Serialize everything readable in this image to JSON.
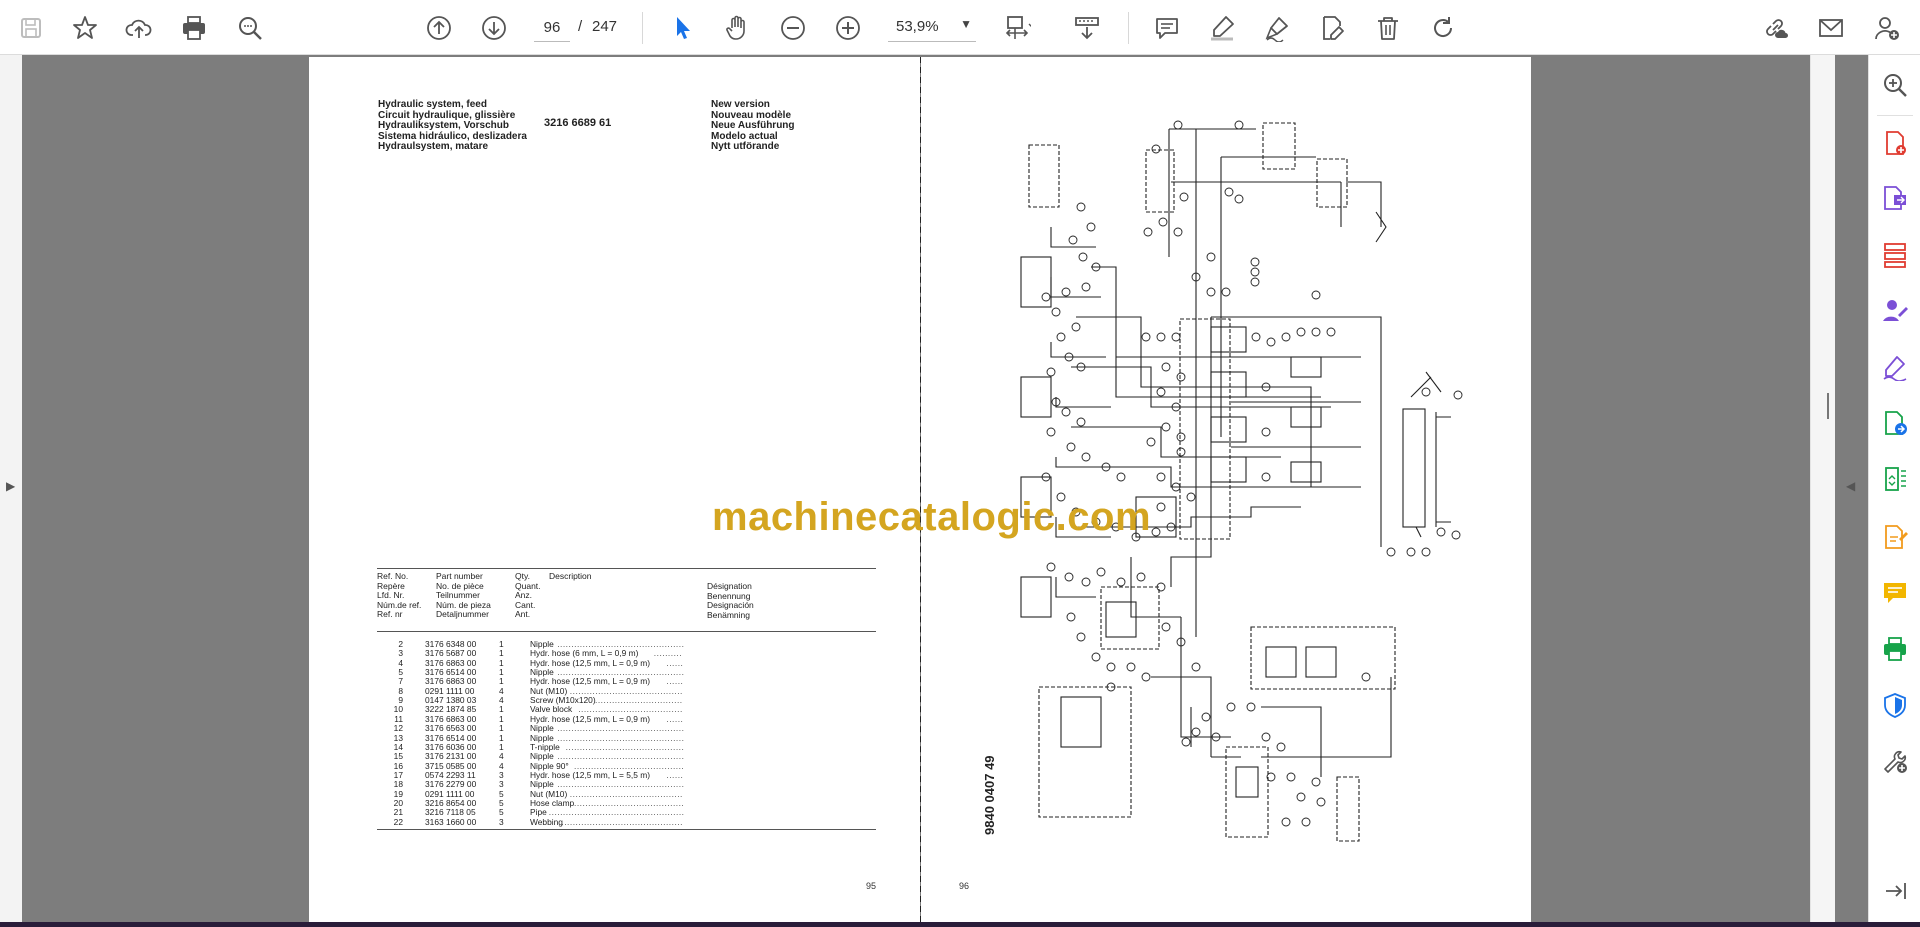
{
  "toolbar": {
    "icons": [
      "save-icon",
      "bookmark-star-icon",
      "upload-cloud-icon",
      "print-icon",
      "search-zoom-icon",
      "arrow-up-circle-icon",
      "arrow-down-circle-icon",
      "select-cursor-icon",
      "hand-pan-icon",
      "zoom-out-icon",
      "zoom-in-icon",
      "page-fit-icon",
      "scroll-mode-icon",
      "comment-icon",
      "highlight-pen-icon",
      "draw-pen-icon",
      "edit-text-icon",
      "trash-icon",
      "rotate-icon",
      "link-cloud-icon",
      "mail-icon",
      "user-add-icon"
    ],
    "current_page": "96",
    "separator": "/",
    "total_pages": "247",
    "zoom": "53,9%"
  },
  "colors": {
    "viewer_bg": "#7d7d7d",
    "watermark": "#d4a520",
    "accent_blue": "#1a73e8",
    "sidebar_red": "#e03c31",
    "sidebar_purple": "#7b4fd6",
    "sidebar_green": "#17a34a",
    "sidebar_orange": "#f29b1d",
    "sidebar_yellow": "#f2b600"
  },
  "left_page": {
    "title_lines": "Hydraulic system, feed\nCircuit hydraulique, glissière\nHydrauliksystem, Vorschub\nSistema hidráulico, deslizadera\nHydraulsystem, matare",
    "part_number": "3216 6689 61",
    "version_lines": "New version\nNouveau modèle\nNeue Ausführung\nModelo actual\nNytt utförande",
    "col_ref": "Ref. No.\nRepère\nLfd. Nr.\nNúm.de ref.\nRef. nr",
    "col_part": "Part number\nNo. de pièce\nTeilnummer\nNúm. de pieza\nDetaljnummer",
    "col_qty": "Qty.\nQuant.\nAnz.\nCant.\nAnt.",
    "col_desc": "Description",
    "col_desc2": "Désignation\nBenennung\nDesignación\nBenämning",
    "rows": [
      {
        "ref": "2",
        "part": "3176 6348 00",
        "qty": "1",
        "desc": "Nipple"
      },
      {
        "ref": "3",
        "part": "3176 5687 00",
        "qty": "1",
        "desc": "Hydr. hose (6 mm, L =  0,9 m)"
      },
      {
        "ref": "4",
        "part": "3176 6863 00",
        "qty": "1",
        "desc": "Hydr. hose (12,5 mm, L =  0,9 m)"
      },
      {
        "ref": "5",
        "part": "3176 6514 00",
        "qty": "1",
        "desc": "Nipple"
      },
      {
        "ref": "7",
        "part": "3176 6863 00",
        "qty": "1",
        "desc": "Hydr. hose (12,5 mm, L =  0,9 m)"
      },
      {
        "ref": "8",
        "part": "0291 1111 00",
        "qty": "4",
        "desc": "Nut (M10)"
      },
      {
        "ref": "9",
        "part": "0147 1380 03",
        "qty": "4",
        "desc": "Screw (M10x120)"
      },
      {
        "ref": "10",
        "part": "3222 1874 85",
        "qty": "1",
        "desc": "Valve block"
      },
      {
        "ref": "11",
        "part": "3176 6863 00",
        "qty": "1",
        "desc": "Hydr. hose (12,5 mm, L =  0,9 m)"
      },
      {
        "ref": "12",
        "part": "3176 6563 00",
        "qty": "1",
        "desc": "Nipple"
      },
      {
        "ref": "13",
        "part": "3176 6514 00",
        "qty": "1",
        "desc": "Nipple"
      },
      {
        "ref": "14",
        "part": "3176 6036 00",
        "qty": "1",
        "desc": "T-nipple"
      },
      {
        "ref": "15",
        "part": "3176 2131 00",
        "qty": "4",
        "desc": "Nipple"
      },
      {
        "ref": "16",
        "part": "3715 0585 00",
        "qty": "4",
        "desc": "Nipple 90°"
      },
      {
        "ref": "17",
        "part": "0574 2293 11",
        "qty": "3",
        "desc": "Hydr. hose (12,5 mm, L =  5,5 m)"
      },
      {
        "ref": "18",
        "part": "3176 2279 00",
        "qty": "3",
        "desc": "Nipple"
      },
      {
        "ref": "19",
        "part": "0291 1111 00",
        "qty": "5",
        "desc": "Nut (M10)"
      },
      {
        "ref": "20",
        "part": "3216 8654 00",
        "qty": "5",
        "desc": "Hose clamp"
      },
      {
        "ref": "21",
        "part": "3216 7118 05",
        "qty": "5",
        "desc": "Pipe"
      },
      {
        "ref": "22",
        "part": "3163 1660 00",
        "qty": "3",
        "desc": "Webbing"
      }
    ],
    "page_number": "95"
  },
  "right_page": {
    "page_number": "96",
    "doc_number": "9840 0407 49"
  },
  "watermark": "machinecatalogic.com",
  "sidebar": {
    "icons": [
      "zoom-search-icon",
      "create-pdf-icon",
      "export-pdf-icon",
      "organize-pages-icon",
      "request-signature-icon",
      "fill-sign-icon",
      "send-file-icon",
      "compress-icon",
      "edit-pdf-icon",
      "comment-bubble-icon",
      "print-production-icon",
      "protect-shield-icon",
      "tools-icon",
      "expand-panel-icon"
    ]
  }
}
